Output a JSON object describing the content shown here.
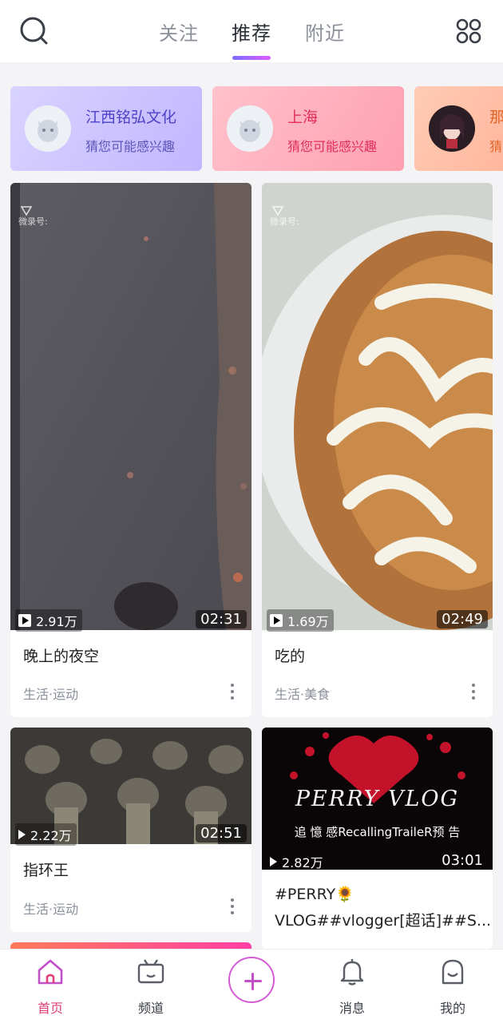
{
  "header": {
    "tabs": [
      {
        "label": "关注"
      },
      {
        "label": "推荐"
      },
      {
        "label": "附近"
      }
    ]
  },
  "suggestions": [
    {
      "name": "江西铭弘文化",
      "hint": "猜您可能感兴趣"
    },
    {
      "name": "上海",
      "hint": "猜您可能感兴趣"
    },
    {
      "name": "那",
      "hint": "猜"
    }
  ],
  "feed": [
    {
      "watermark": "微录号:",
      "plays": "2.91万",
      "duration": "02:31",
      "title": "晚上的夜空",
      "category": "生活·运动"
    },
    {
      "watermark": "微录号:",
      "plays": "1.69万",
      "duration": "02:49",
      "title": "吃的",
      "category": "生活·美食"
    },
    {
      "plays": "2.22万",
      "duration": "02:51",
      "title": "指环王",
      "category": "生活·运动"
    },
    {
      "overlay_title": "PERRY VLOG",
      "overlay_subtitle": "追 憶 感RecallingTraileR预 告",
      "plays": "2.82万",
      "duration": "03:01",
      "title_line1": "#PERRY🌻",
      "title_line2": "VLOG##vlogger[超话]##S..."
    }
  ],
  "nav": [
    {
      "label": "首页"
    },
    {
      "label": "频道"
    },
    {
      "label": "消息"
    },
    {
      "label": "我的"
    }
  ],
  "colors": {
    "accent": "#e0417a",
    "tab_indicator": "#b067ff"
  }
}
